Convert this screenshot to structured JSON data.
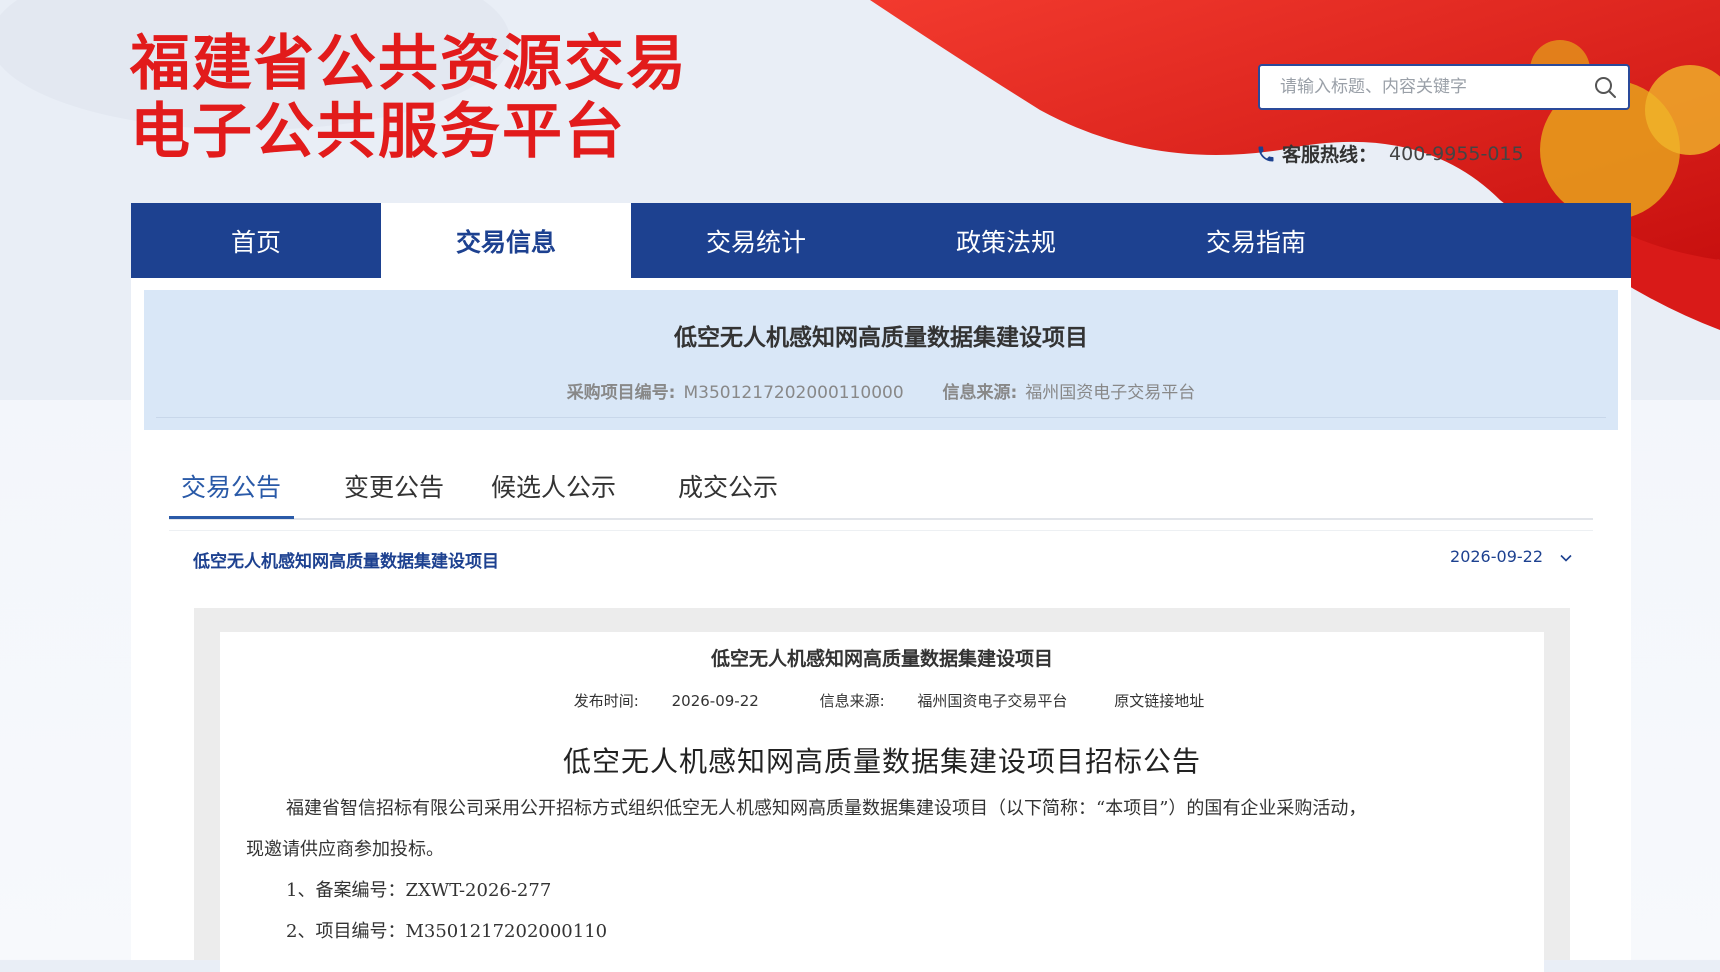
{
  "header": {
    "title_line1": "福建省公共资源交易",
    "title_line2": "电子公共服务平台",
    "search": {
      "placeholder": "请输入标题、内容关键字",
      "icon": "search-icon"
    },
    "hotline": {
      "label": "客服热线：",
      "number": "400-9955-015"
    },
    "brand_color": "#e21b1b"
  },
  "nav": {
    "items": [
      {
        "label": "首页"
      },
      {
        "label": "交易信息"
      },
      {
        "label": "交易统计"
      },
      {
        "label": "政策法规"
      },
      {
        "label": "交易指南"
      }
    ],
    "active_index": 1,
    "color": "#1d4190"
  },
  "project": {
    "title": "低空无人机感知网高质量数据集建设项目",
    "code_label": "采购项目编号:",
    "code_value": "M3501217202000110000",
    "source_label": "信息来源:",
    "source_value": "福州国资电子交易平台"
  },
  "tabs": {
    "items": [
      {
        "label": "交易公告"
      },
      {
        "label": "变更公告"
      },
      {
        "label": "候选人公示"
      },
      {
        "label": "成交公示"
      }
    ],
    "active_index": 0
  },
  "list": {
    "item_title": "低空无人机感知网高质量数据集建设项目",
    "item_date": "2026-09-22"
  },
  "doc": {
    "title": "低空无人机感知网高质量数据集建设项目",
    "publish_label": "发布时间:",
    "publish_value": "2026-09-22",
    "source_label": "信息来源:",
    "source_value": "福州国资电子交易平台",
    "origin_link": "原文链接地址",
    "heading": "低空无人机感知网高质量数据集建设项目招标公告",
    "para1_line1": "福建省智信招标有限公司采用公开招标方式组织低空无人机感知网高质量数据集建设项目（以下简称：“本项目”）的国有企业采购活动，",
    "para1_line2": "现邀请供应商参加投标。",
    "item1": "1、备案编号：ZXWT-2026-277",
    "item2": "2、项目编号：M3501217202000110"
  }
}
